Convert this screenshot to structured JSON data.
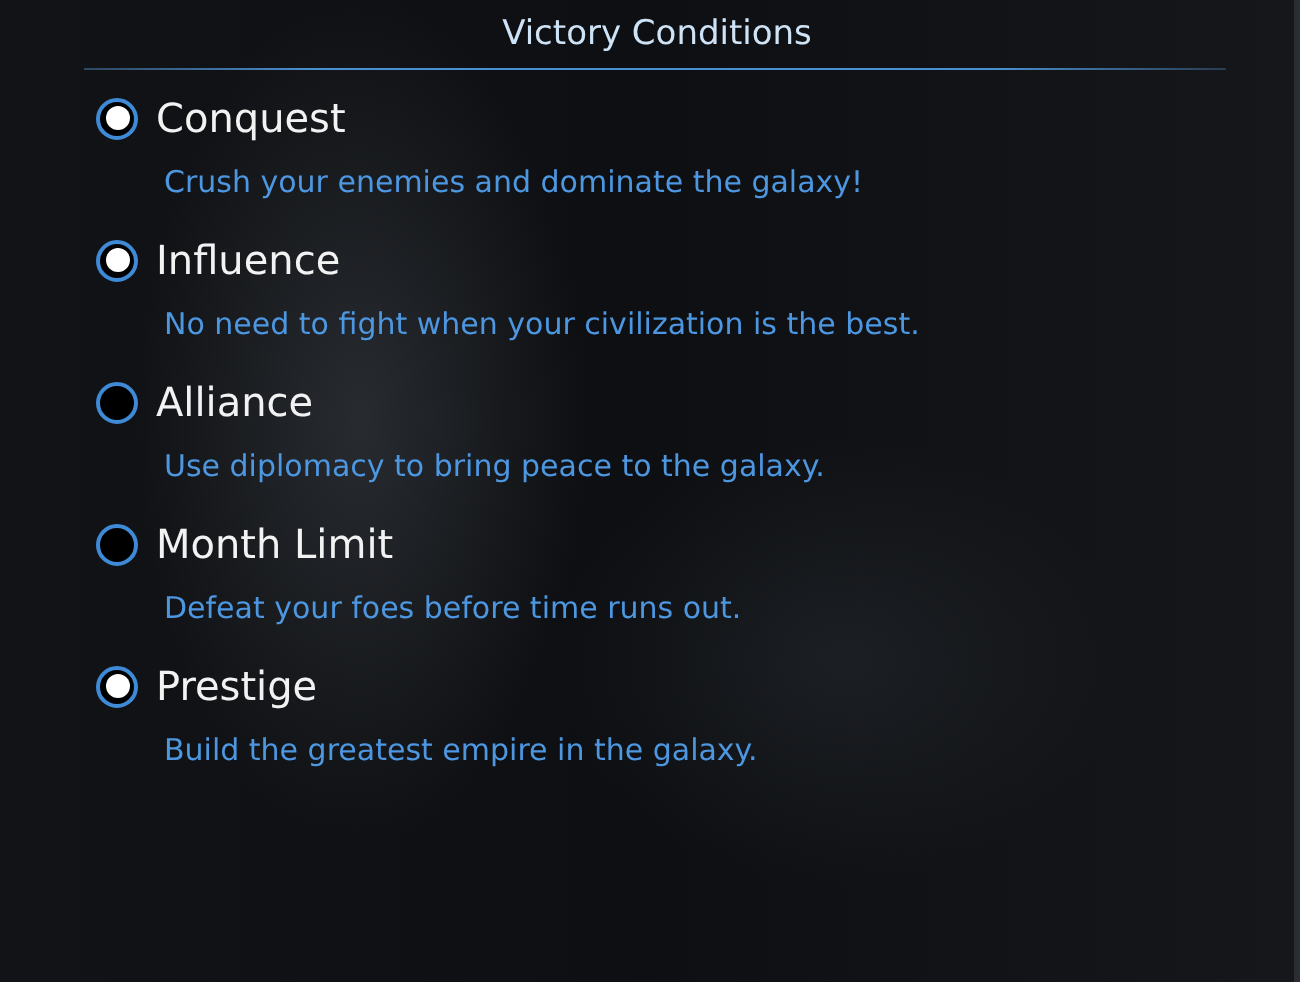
{
  "title": "Victory Conditions",
  "conditions": [
    {
      "label": "Conquest",
      "description": "Crush your enemies and dominate the galaxy!",
      "checked": true
    },
    {
      "label": "Influence",
      "description": "No need to fight when your civilization is the best.",
      "checked": true
    },
    {
      "label": "Alliance",
      "description": "Use diplomacy to bring peace to the galaxy.",
      "checked": false
    },
    {
      "label": "Month Limit",
      "description": "Defeat your foes before time runs out.",
      "checked": false
    },
    {
      "label": "Prestige",
      "description": "Build the greatest empire in the galaxy.",
      "checked": true
    }
  ]
}
